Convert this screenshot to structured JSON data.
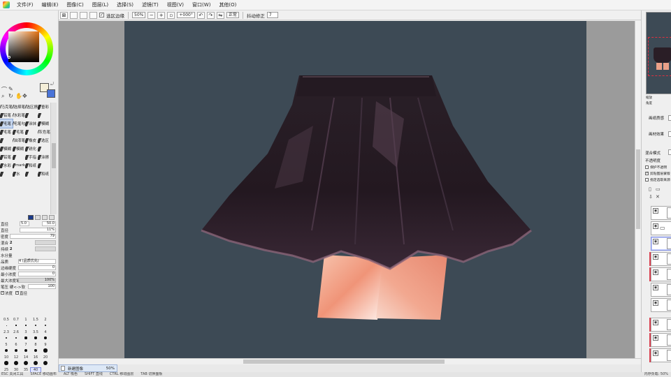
{
  "menu": {
    "items": [
      "文件(F)",
      "编辑(E)",
      "图像(C)",
      "图层(L)",
      "选择(S)",
      "滤镜(T)",
      "视图(V)",
      "窗口(W)",
      "其他(O)"
    ]
  },
  "toolbar": {
    "selection_edge_label": "选区边缘",
    "zoom_value": "50%",
    "rotation_value": "+000°",
    "normal_label": "正常",
    "stabilizer_label": "抖动修正",
    "stabilizer_value": "7"
  },
  "tools": {
    "rows": [
      [
        "马克笔",
        "选择笔",
        "选区擦",
        "垂彩"
      ],
      [
        "铅笔",
        "水彩笔",
        "",
        ""
      ],
      [
        "毛笔",
        "毛笔勾",
        "涂抹",
        "模糊"
      ],
      [
        "毛笔",
        "毛笔",
        "",
        "灰色笔"
      ],
      [
        "",
        "油漆笔",
        "橡皮",
        "选区"
      ],
      [
        "模糊",
        "模糊",
        "锐化",
        ""
      ],
      [
        "铅笔",
        "",
        "手指",
        "涂擦"
      ],
      [
        "水彩",
        "mark",
        "和纸",
        ""
      ],
      [
        "",
        "水",
        "",
        "和纸"
      ]
    ]
  },
  "brush_settings": {
    "size_label": "直径",
    "size_min": "5.0",
    "size_max": "50.0",
    "density_label": "密度",
    "density_value": "79",
    "opacity_percent": "11%",
    "blend_label": "混合",
    "blend_value": "2",
    "persistence_label": "持续",
    "persistence_value": "2",
    "water_label": "水分量",
    "quality_label": "品质",
    "quality_value": "4 (品质优先)",
    "edge_label": "边缘硬度",
    "edge_value": "0",
    "min_density_label": "最小浓度",
    "min_density_value": "0",
    "max_density_label": "最大浓度笔压",
    "max_density_value": "100%",
    "pressure_label": "笔压 硬<->软",
    "pressure_value": "100",
    "pressure_density_label": "浓度",
    "pressure_size_label": "直径"
  },
  "size_presets": [
    "0.5",
    "0.7",
    "1",
    "1.5",
    "2",
    "2.3",
    "2.6",
    "3",
    "3.5",
    "4",
    "5",
    "6",
    "7",
    "8",
    "9",
    "10",
    "12",
    "14",
    "16",
    "20",
    "25",
    "30",
    "35",
    "40"
  ],
  "canvas_tab": {
    "name": "新建图像",
    "zoom": "50%"
  },
  "statusbar": {
    "items": [
      "ESC 关闭工具",
      "SPACE 移动画布",
      "ALT 吸色",
      "SHIFT 直线",
      "CTRL 移动图层",
      "TAB 切换面板"
    ],
    "memory": "内存负载: 50%"
  },
  "right_panel": {
    "paper_texture_label": "画纸质感",
    "paper_effect_label": "画材效果",
    "blend_mode_label": "混合模式",
    "opacity_label": "不透明度",
    "protect_alpha_label": "保护不透明",
    "clip_group_label": "剪贴图层蒙版",
    "selection_source_label": "指定选取来源",
    "nav_zoom_label": "缩放",
    "nav_angle_label": "角度"
  },
  "colors": {
    "canvas_background": "#3d4a55",
    "foreground_color": "#f4eed8",
    "background_color": "#4a74d8",
    "skirt": "#2a1e26",
    "skin": "#f0a888",
    "accent_selection": "#7f8ee0"
  }
}
